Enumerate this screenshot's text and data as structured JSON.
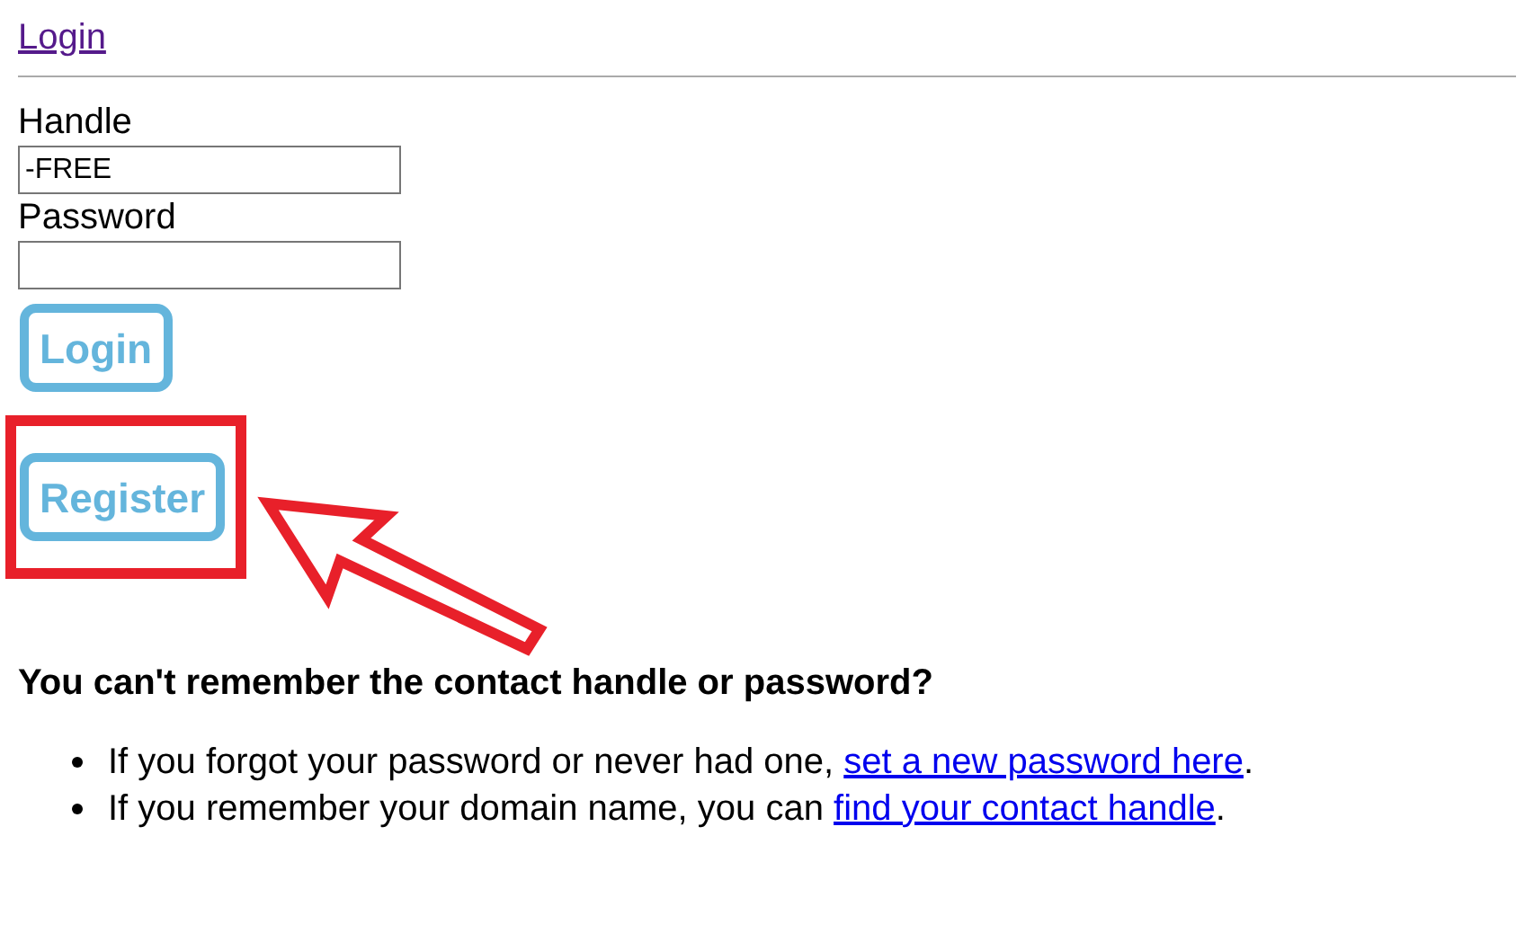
{
  "top_link": "Login",
  "form": {
    "fields": [
      {
        "label": "Handle",
        "value": "-FREE"
      },
      {
        "label": "Password"
      }
    ],
    "buttons": [
      {
        "label": "Login"
      },
      {
        "label": "Register"
      }
    ]
  },
  "highlight_box": {
    "color": "#e8202a"
  },
  "arrow": {
    "color": "#e8202a"
  },
  "help": {
    "heading": "You can't remember the contact handle or password?",
    "items": [
      {
        "text": "If you forgot your password or never had one, ",
        "link": "set a new password here",
        "after": "."
      },
      {
        "text": "If you remember your domain name, you can ",
        "link": "find your contact handle",
        "after": "."
      }
    ]
  }
}
